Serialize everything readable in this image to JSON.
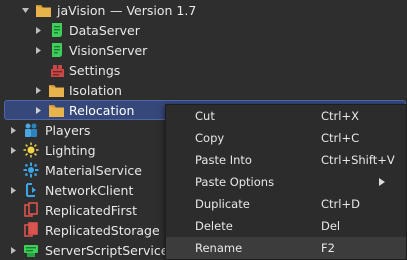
{
  "tree": {
    "items": [
      {
        "label": "jaVision",
        "suffix": "— Version 1.7",
        "icon": "folder-icon"
      },
      {
        "label": "DataServer",
        "icon": "script-icon"
      },
      {
        "label": "VisionServer",
        "icon": "script-icon"
      },
      {
        "label": "Settings",
        "icon": "module-script-icon"
      },
      {
        "label": "Isolation",
        "icon": "folder-icon"
      },
      {
        "label": "Relocation",
        "icon": "folder-icon"
      },
      {
        "label": "Players",
        "icon": "players-icon"
      },
      {
        "label": "Lighting",
        "icon": "lighting-icon"
      },
      {
        "label": "MaterialService",
        "icon": "material-service-icon"
      },
      {
        "label": "NetworkClient",
        "icon": "network-client-icon"
      },
      {
        "label": "ReplicatedFirst",
        "icon": "replicated-first-icon"
      },
      {
        "label": "ReplicatedStorage",
        "icon": "replicated-storage-icon"
      },
      {
        "label": "ServerScriptService",
        "icon": "server-script-service-icon"
      }
    ]
  },
  "context_menu": {
    "items": [
      {
        "label": "Cut",
        "shortcut": "Ctrl+X"
      },
      {
        "label": "Copy",
        "shortcut": "Ctrl+C"
      },
      {
        "label": "Paste Into",
        "shortcut": "Ctrl+Shift+V"
      },
      {
        "label": "Paste Options",
        "shortcut": ""
      },
      {
        "label": "Duplicate",
        "shortcut": "Ctrl+D"
      },
      {
        "label": "Delete",
        "shortcut": "Del"
      },
      {
        "label": "Rename",
        "shortcut": "F2"
      }
    ]
  },
  "colors": {
    "background": "#2e2e2e",
    "selection": "#36477a",
    "folder": "#e8b34b",
    "script": "#3ecf5a",
    "module_script": "#c84848",
    "menu_background": "#2c2c2c",
    "menu_hover": "#3c3c3c"
  }
}
